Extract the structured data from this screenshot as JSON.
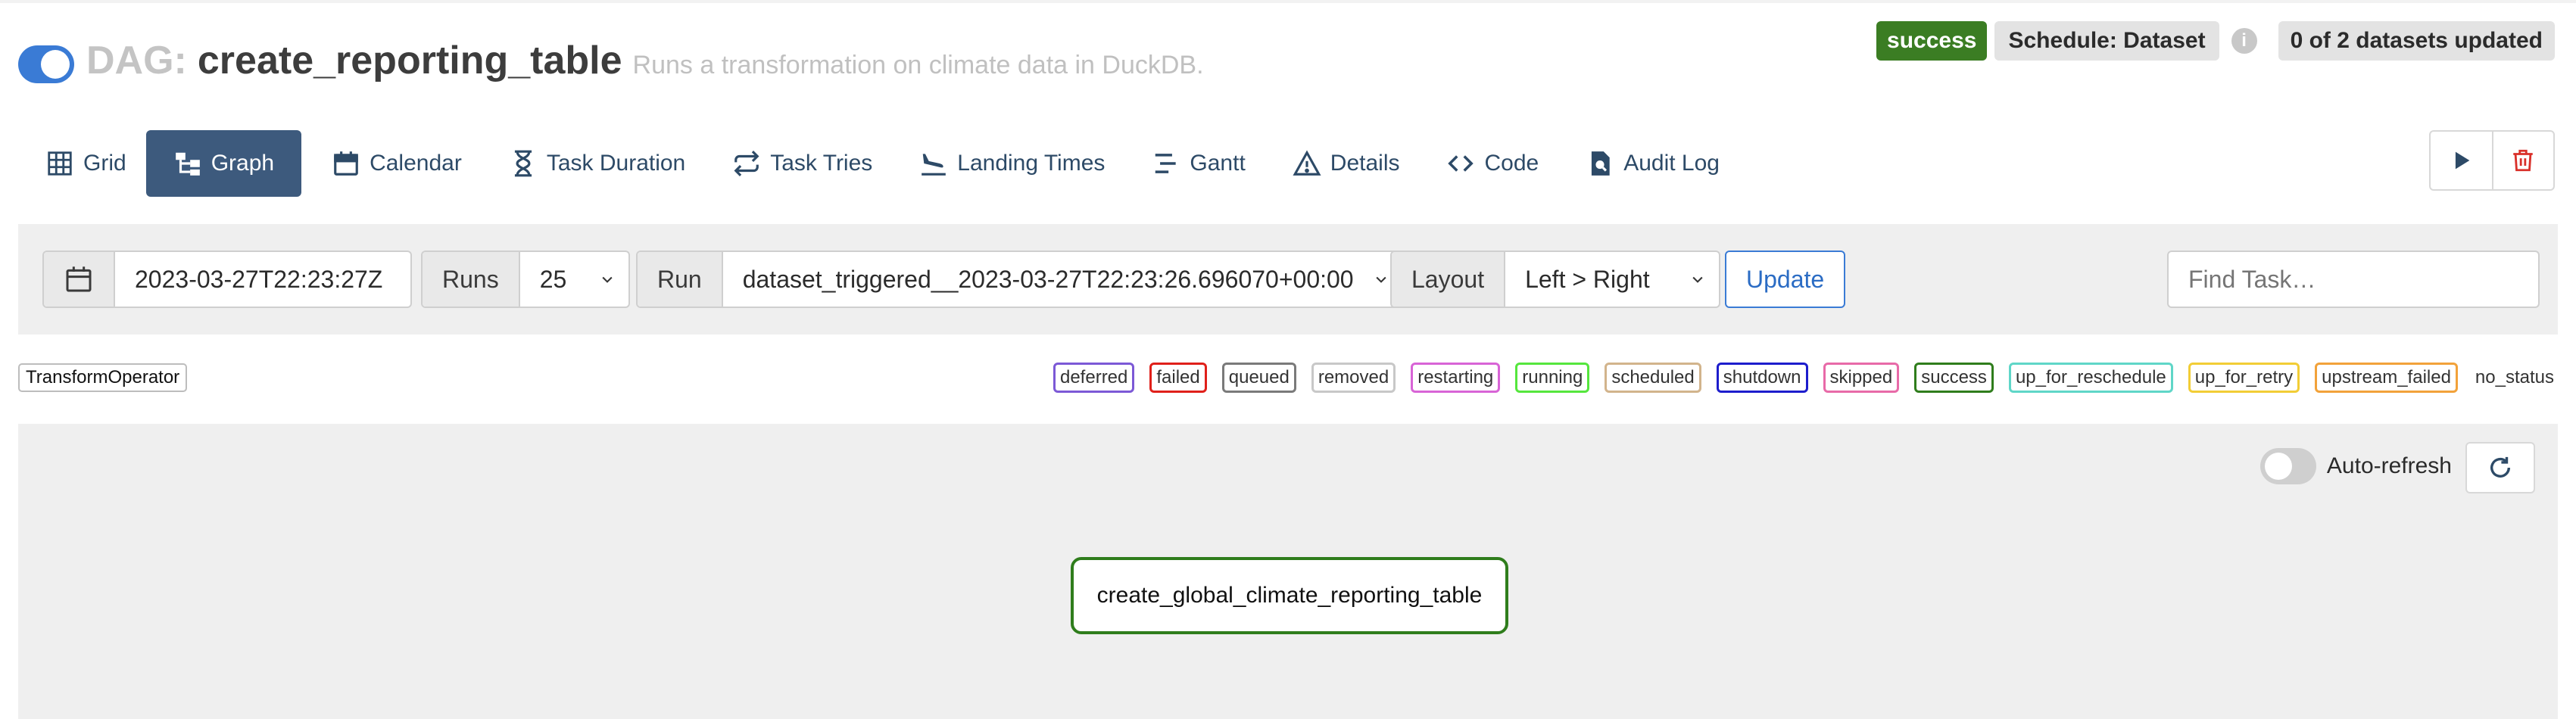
{
  "header": {
    "dag_prefix": "DAG:",
    "dag_name": "create_reporting_table",
    "description": "Runs a transformation on climate data in DuckDB.",
    "status_badge": "success",
    "schedule_badge": "Schedule: Dataset",
    "info_icon": "i",
    "datasets_badge": "0 of 2 datasets updated",
    "pause_toggle_on": true
  },
  "nav": {
    "tabs": [
      {
        "label": "Grid",
        "icon": "grid-icon"
      },
      {
        "label": "Graph",
        "icon": "graph-icon",
        "active": true
      },
      {
        "label": "Calendar",
        "icon": "calendar-icon"
      },
      {
        "label": "Task Duration",
        "icon": "hourglass-icon"
      },
      {
        "label": "Task Tries",
        "icon": "repeat-icon"
      },
      {
        "label": "Landing Times",
        "icon": "plane-landing-icon"
      },
      {
        "label": "Gantt",
        "icon": "gantt-icon"
      },
      {
        "label": "Details",
        "icon": "warning-triangle-icon"
      },
      {
        "label": "Code",
        "icon": "code-icon"
      },
      {
        "label": "Audit Log",
        "icon": "file-search-icon"
      }
    ],
    "actions": [
      {
        "name": "trigger-dag",
        "icon": "play-icon"
      },
      {
        "name": "delete-dag",
        "icon": "trash-icon"
      }
    ]
  },
  "controls": {
    "base_date": "2023-03-27T22:23:27Z",
    "runs_label": "Runs",
    "runs_value": "25",
    "run_label": "Run",
    "run_value": "dataset_triggered__2023-03-27T22:23:26.696070+00:00",
    "layout_label": "Layout",
    "layout_value": "Left > Right",
    "update_label": "Update",
    "find_task_placeholder": "Find Task…"
  },
  "legend": {
    "operator": "TransformOperator",
    "states": [
      {
        "label": "deferred",
        "color": "#7c59d6"
      },
      {
        "label": "failed",
        "color": "#e0201a"
      },
      {
        "label": "queued",
        "color": "#7a7a7a"
      },
      {
        "label": "removed",
        "color": "#c8c8c8"
      },
      {
        "label": "restarting",
        "color": "#d864d6"
      },
      {
        "label": "running",
        "color": "#55e63d"
      },
      {
        "label": "scheduled",
        "color": "#d2b48c"
      },
      {
        "label": "shutdown",
        "color": "#1d1dcc"
      },
      {
        "label": "skipped",
        "color": "#e86aa8"
      },
      {
        "label": "success",
        "color": "#2f7d1c"
      },
      {
        "label": "up_for_reschedule",
        "color": "#5fd6c8"
      },
      {
        "label": "up_for_retry",
        "color": "#f2cd36"
      },
      {
        "label": "upstream_failed",
        "color": "#f2a23a"
      },
      {
        "label": "no_status",
        "color": "none"
      }
    ]
  },
  "graph": {
    "auto_refresh_label": "Auto-refresh",
    "auto_refresh_on": false,
    "task_node": "create_global_climate_reporting_table",
    "task_state_color": "#2f7d1c"
  },
  "colors": {
    "primary": "#3a7bd5",
    "nav_active": "#3d5a7d",
    "success": "#3b7d23",
    "danger": "#d9302a"
  }
}
